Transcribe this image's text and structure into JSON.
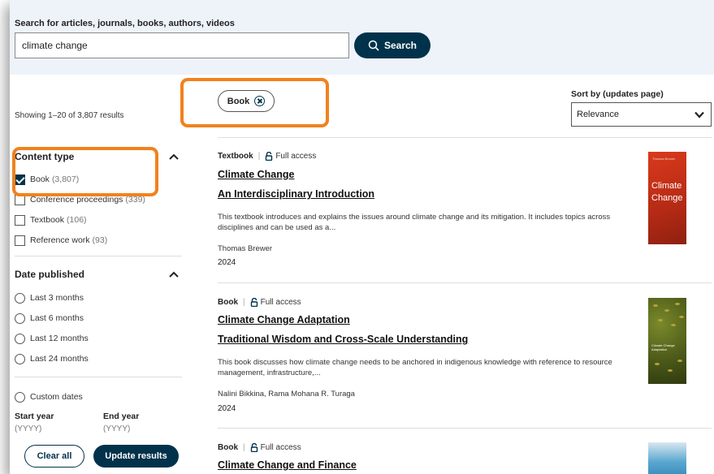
{
  "search": {
    "label": "Search for articles, journals, books, authors, videos",
    "value": "climate change",
    "button_label": "Search"
  },
  "sidebar": {
    "showing": "Showing 1–20 of 3,807 results",
    "content_type": {
      "title": "Content type",
      "options": [
        {
          "label": "Book",
          "count": "(3,807)",
          "checked": true
        },
        {
          "label": "Conference proceedings",
          "count": "(339)",
          "checked": false
        },
        {
          "label": "Textbook",
          "count": "(106)",
          "checked": false
        },
        {
          "label": "Reference work",
          "count": "(93)",
          "checked": false
        }
      ]
    },
    "date_published": {
      "title": "Date published",
      "options": [
        "Last 3 months",
        "Last 6 months",
        "Last 12 months",
        "Last 24 months"
      ],
      "custom": "Custom dates",
      "start_label": "Start year",
      "start_placeholder": "(YYYY)",
      "end_label": "End year",
      "end_placeholder": "(YYYY)"
    },
    "clear_label": "Clear all",
    "update_label": "Update results"
  },
  "filter_chip": {
    "label": "Book"
  },
  "sort": {
    "label": "Sort by (updates page)",
    "value": "Relevance"
  },
  "results": [
    {
      "type": "Textbook",
      "access": "Full access",
      "title": "Climate Change",
      "subtitle": "An Interdisciplinary Introduction",
      "description": "This textbook introduces and explains the issues around climate change and its mitigation. It includes topics across disciplines and can be used as a...",
      "authors": "Thomas Brewer",
      "year": "2024",
      "cover_author": "Thomas Brewer",
      "cover_title_1": "Climate",
      "cover_title_2": "Change"
    },
    {
      "type": "Book",
      "access": "Full access",
      "title": "Climate Change Adaptation",
      "subtitle": "Traditional Wisdom and Cross-Scale Understanding",
      "description": "This book discusses how climate change needs to be anchored in indigenous knowledge with reference to resource management, infrastructure,...",
      "authors": "Nalini Bikkina, Rama Mohana R. Turaga",
      "year": "2024",
      "cover_title": "Climate Change Adaptation"
    },
    {
      "type": "Book",
      "access": "Full access",
      "title": "Climate Change and Finance"
    }
  ],
  "colors": {
    "accent": "#01324b",
    "highlight": "#f0821e"
  }
}
